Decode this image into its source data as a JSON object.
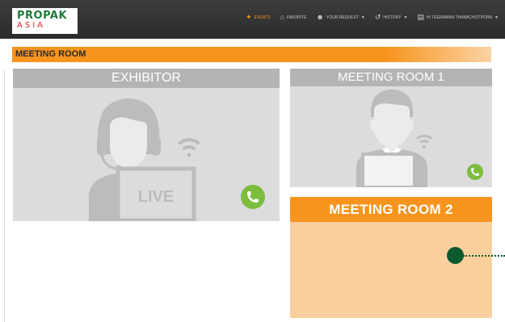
{
  "logo": {
    "line1": "PROPAK",
    "line2": "ASIA"
  },
  "nav": [
    {
      "label": "Events",
      "icon": "sparkle-icon",
      "caret": false,
      "active": true
    },
    {
      "label": "Favorite",
      "icon": "home-icon",
      "caret": false,
      "active": false
    },
    {
      "label": "Your Request",
      "icon": "users-icon",
      "caret": true,
      "active": false
    },
    {
      "label": "History",
      "icon": "history-icon",
      "caret": true,
      "active": false
    },
    {
      "label": "Hi Teerawan Thanachotporn",
      "icon": "user-card-icon",
      "caret": true,
      "active": false
    }
  ],
  "section": {
    "title": "MEETING ROOM"
  },
  "exhibitor": {
    "title": "EXHIBITOR",
    "live_label": "LIVE"
  },
  "room1": {
    "title": "MEETING ROOM 1"
  },
  "room2": {
    "title": "MEETING ROOM 2"
  },
  "colors": {
    "nav_bg": "#2f2f2f",
    "accent_orange": "#f7941d",
    "room2_body": "#f9cf9c",
    "panel_gray": "#dcdcdc",
    "figure_gray": "#bcbcbc",
    "call_green": "#7bbd3c",
    "dot_green": "#0d5a2e"
  }
}
